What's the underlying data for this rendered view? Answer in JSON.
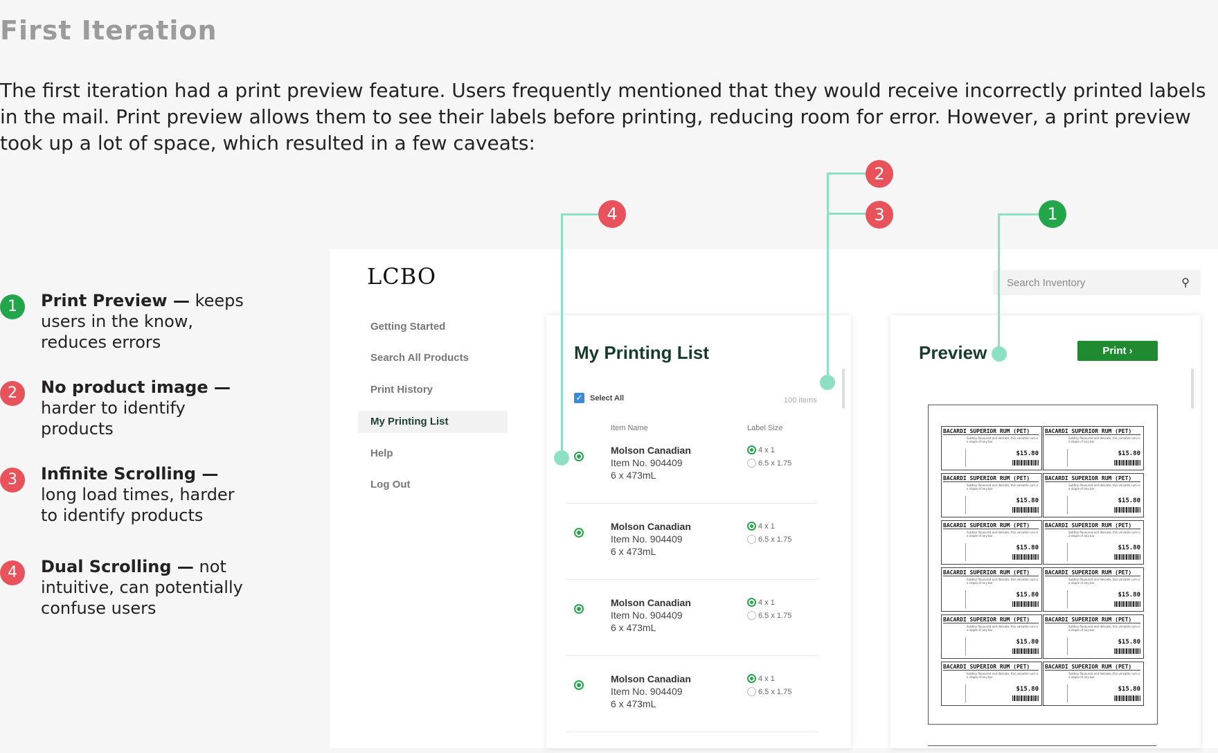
{
  "page": {
    "title": "First Iteration",
    "intro": "The first iteration had a print preview feature. Users frequently mentioned that they would receive incorrectly printed labels in the mail. Print preview allows them to see their labels before printing, reducing room for error. However, a print preview took up a lot of space, which resulted in a few caveats:"
  },
  "caveats": [
    {
      "num": "1",
      "bold": "Print Preview —",
      "text": " keeps users in the know, reduces errors",
      "color": "#23a64a"
    },
    {
      "num": "2",
      "bold": "No product image —",
      "text": " harder to identify products",
      "color": "#e8525a"
    },
    {
      "num": "3",
      "bold": "Infinite Scrolling —",
      "text": " long load times, harder to identify products",
      "color": "#e8525a"
    },
    {
      "num": "4",
      "bold": "Dual Scrolling —",
      "text": " not intuitive, can potentially confuse users",
      "color": "#e8525a"
    }
  ],
  "annotations": {
    "a1": "1",
    "a2": "2",
    "a3": "3",
    "a4": "4"
  },
  "app": {
    "logo": "LCBO",
    "search_placeholder": "Search Inventory",
    "search_icon": "search-icon",
    "nav": [
      "Getting Started",
      "Search All Products",
      "Print History",
      "My Printing List",
      "Help",
      "Log Out"
    ],
    "active_nav": "My Printing List",
    "list": {
      "title": "My Printing List",
      "select_all": "Select All",
      "count": "100 items",
      "col_item": "Item Name",
      "col_size": "Label Size",
      "rows": [
        {
          "name": "Molson Canadian",
          "item": "Item No. 904409",
          "pack": "6 x 473mL",
          "opt1": "4 x 1",
          "opt2": "6.5 x 1.75"
        },
        {
          "name": "Molson Canadian",
          "item": "Item No. 904409",
          "pack": "6 x 473mL",
          "opt1": "4 x 1",
          "opt2": "6.5 x 1.75"
        },
        {
          "name": "Molson Canadian",
          "item": "Item No. 904409",
          "pack": "6 x 473mL",
          "opt1": "4 x 1",
          "opt2": "6.5 x 1.75"
        },
        {
          "name": "Molson Canadian",
          "item": "Item No. 904409",
          "pack": "6 x 473mL",
          "opt1": "4 x 1",
          "opt2": "6.5 x 1.75"
        }
      ]
    },
    "preview": {
      "title": "Preview",
      "print_label": "Print",
      "label_name": "BACARDI SUPERIOR RUM (PET)",
      "label_desc": "Subtley flavoured and delicate, this versatile rum is a staple of any bar",
      "label_price": "$15.80"
    }
  },
  "colors": {
    "accent_green": "#23a64a",
    "accent_red": "#e8525a",
    "line": "#8ee0c4",
    "title_green": "#173d2a"
  }
}
